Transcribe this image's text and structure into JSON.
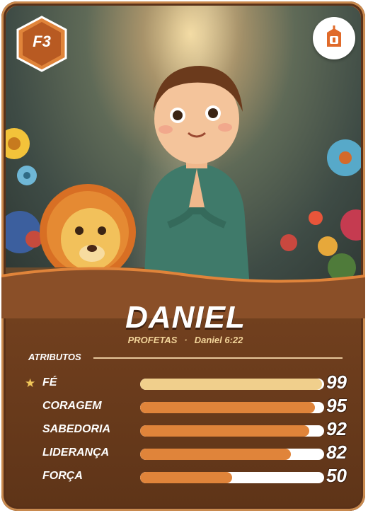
{
  "card": {
    "badge": "F3",
    "name": "DANIEL",
    "category": "PROFETAS",
    "separator": "·",
    "reference": "Daniel 6:22",
    "emblem_icon": "church-emblem-icon",
    "accent": "#e0843a",
    "highlight": "#f0cf8c"
  },
  "attributes": {
    "heading": "ATRIBUTOS",
    "items": [
      {
        "label": "FÉ",
        "value": "99",
        "fill": 0.99,
        "starred": true
      },
      {
        "label": "CORAGEM",
        "value": "95",
        "fill": 0.95,
        "starred": false
      },
      {
        "label": "SABEDORIA",
        "value": "92",
        "fill": 0.92,
        "starred": false
      },
      {
        "label": "LIDERANÇA",
        "value": "82",
        "fill": 0.82,
        "starred": false
      },
      {
        "label": "FORÇA",
        "value": "50",
        "fill": 0.5,
        "starred": false
      }
    ]
  }
}
